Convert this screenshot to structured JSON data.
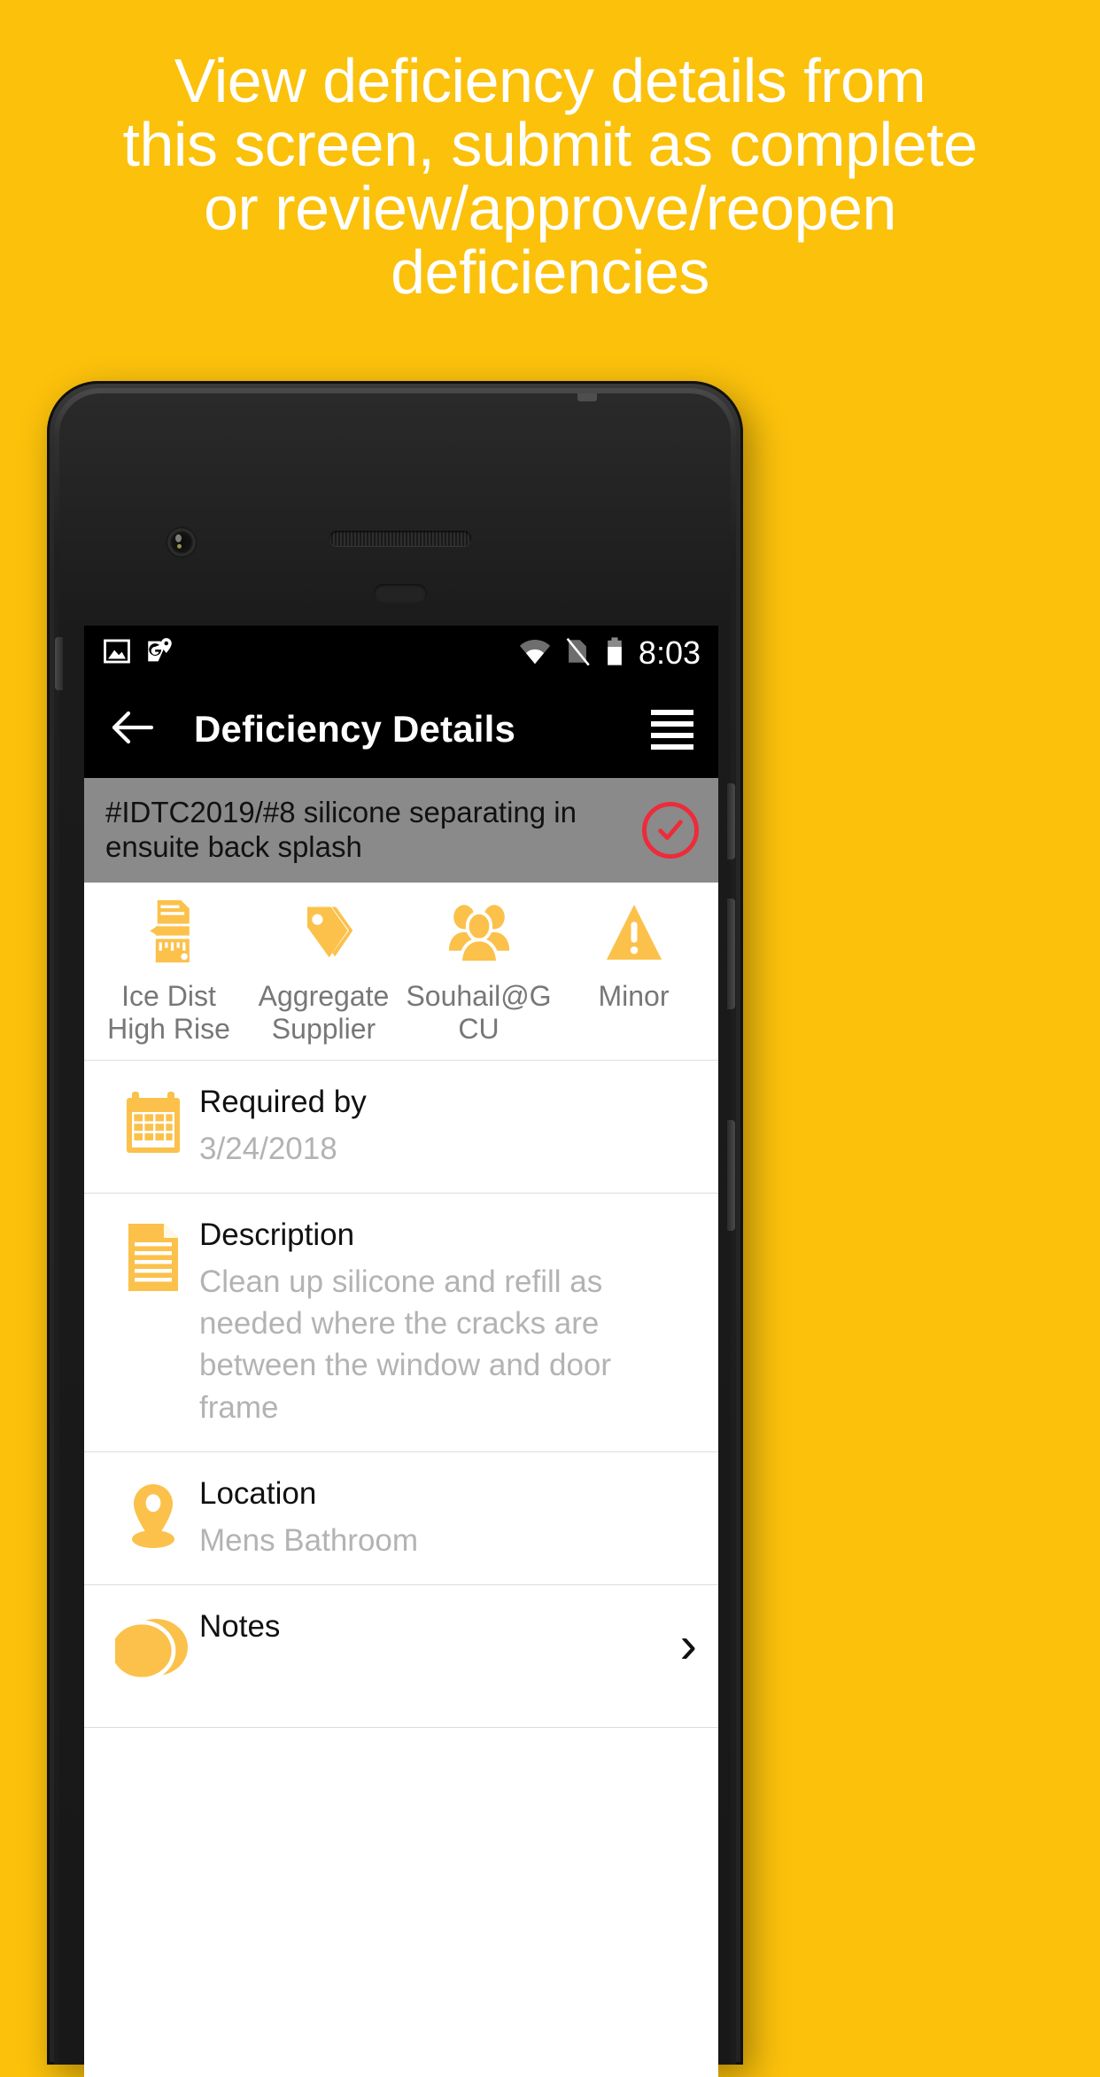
{
  "promo": {
    "headline": "View deficiency details from\nthis screen, submit as complete\nor review/approve/reopen\ndeficiencies",
    "background_color": "#FBC10B",
    "text_color": "#FFFFFF"
  },
  "theme": {
    "accent": "#FBC14B",
    "status_red": "#ED2B3A",
    "header_gray": "#8A8A8A",
    "value_gray": "#B3B3B3",
    "label_gray": "#777777"
  },
  "statusbar": {
    "time": "8:03",
    "left_icons": [
      "image-icon",
      "google-maps-pin-icon"
    ],
    "right_icons": [
      "wifi-icon",
      "no-sim-icon",
      "battery-icon"
    ]
  },
  "appbar": {
    "back_icon": "back-arrow-icon",
    "title": "Deficiency Details",
    "menu_icon": "hamburger-menu-icon"
  },
  "deficiency_header": {
    "title": "#IDTC2019/#8 silicone separating in ensuite back splash",
    "status_icon": "check-circle-icon"
  },
  "meta": [
    {
      "icon": "blueprint-ruler-icon",
      "label": "Ice Dist High Rise"
    },
    {
      "icon": "tag-icon",
      "label": "Aggregate Supplier"
    },
    {
      "icon": "people-icon",
      "label": "Souhail@GCU"
    },
    {
      "icon": "warning-triangle-icon",
      "label": "Minor"
    }
  ],
  "details": [
    {
      "icon": "calendar-icon",
      "label": "Required by",
      "value": "3/24/2018",
      "chevron": false
    },
    {
      "icon": "document-icon",
      "label": "Description",
      "value": "Clean up silicone and refill as needed where the cracks are between the window and door frame",
      "chevron": false
    },
    {
      "icon": "location-pin-icon",
      "label": "Location",
      "value": "Mens Bathroom",
      "chevron": false
    },
    {
      "icon": "notes-bubble-icon",
      "label": "Notes",
      "value": "",
      "chevron": true,
      "chevron_glyph": "›"
    }
  ]
}
